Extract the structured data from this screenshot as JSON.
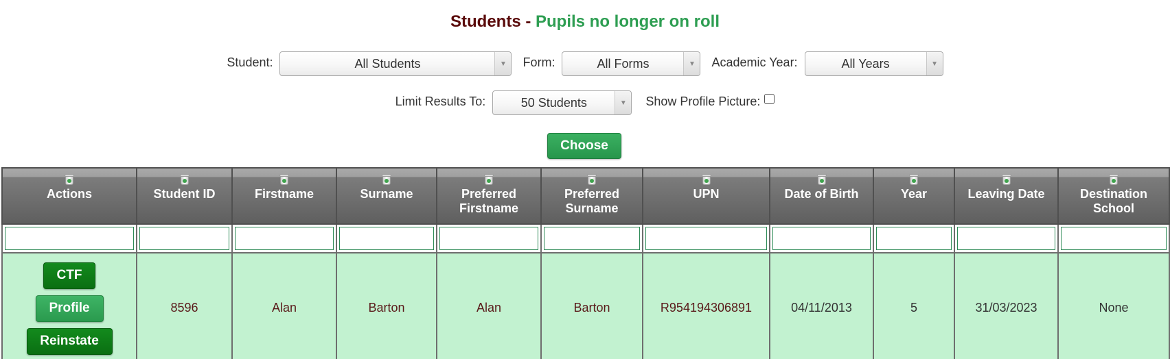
{
  "title": {
    "main": "Students - ",
    "sub": "Pupils no longer on roll"
  },
  "filters": {
    "student": {
      "label": "Student:",
      "value": "All Students"
    },
    "form": {
      "label": "Form:",
      "value": "All Forms"
    },
    "academic_year": {
      "label": "Academic Year:",
      "value": "All Years"
    },
    "limit": {
      "label": "Limit Results To:",
      "value": "50 Students"
    },
    "show_profile_picture": {
      "label": "Show Profile Picture:",
      "checked": false
    }
  },
  "choose_button": "Choose",
  "colors": {
    "title_main": "#5a0a0a",
    "title_sub": "#2e9e52",
    "row_background": "#c2f2d0",
    "button_green": "#2a9a4e",
    "button_dark_green": "#0a6f12"
  },
  "table": {
    "header_icon": "recycle-bin-icon",
    "columns": [
      "Actions",
      "Student ID",
      "Firstname",
      "Surname",
      "Preferred Firstname",
      "Preferred Surname",
      "UPN",
      "Date of Birth",
      "Year",
      "Leaving Date",
      "Destination School"
    ],
    "rows": [
      {
        "actions": [
          "CTF",
          "Profile",
          "Reinstate"
        ],
        "student_id": "8596",
        "firstname": "Alan",
        "surname": "Barton",
        "preferred_firstname": "Alan",
        "preferred_surname": "Barton",
        "upn": "R954194306891",
        "date_of_birth": "04/11/2013",
        "year": "5",
        "leaving_date": "31/03/2023",
        "destination_school": "None"
      }
    ]
  }
}
